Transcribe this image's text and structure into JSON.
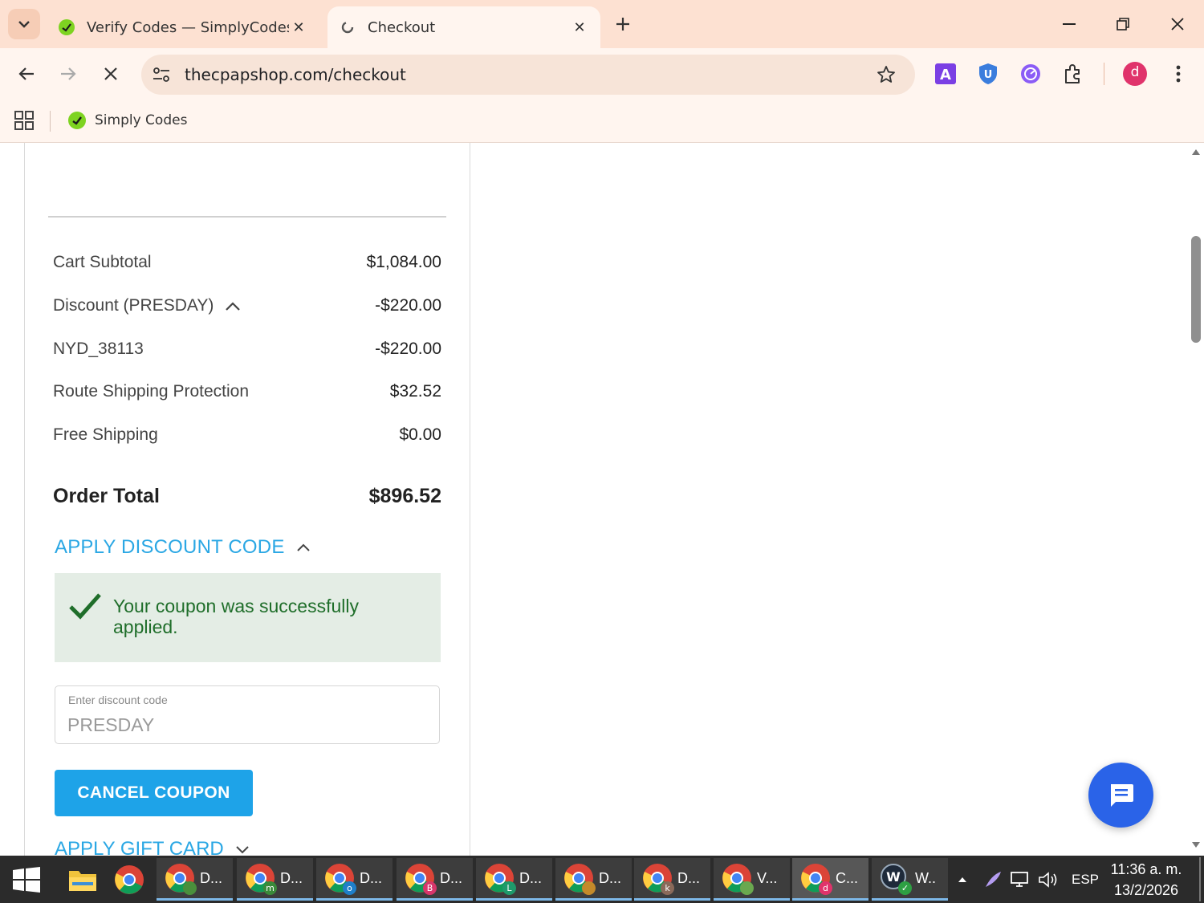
{
  "browser": {
    "tabs": [
      {
        "title": "Verify Codes — SimplyCodes",
        "active": false
      },
      {
        "title": "Checkout",
        "active": true
      }
    ],
    "url": "thecpapshop.com/checkout",
    "bookmarks": [
      {
        "label": "Simply Codes"
      }
    ],
    "profile_initial": "d",
    "extensions": [
      "a-extension-icon",
      "shield-extension-icon",
      "gauge-extension-icon",
      "puzzle-extensions-icon"
    ]
  },
  "summary": {
    "rows": [
      {
        "label": "Cart Subtotal",
        "amount": "$1,084.00"
      },
      {
        "label": "Discount (PRESDAY)",
        "amount": "-$220.00"
      },
      {
        "label": "NYD_38113",
        "amount": "-$220.00"
      },
      {
        "label": "Route Shipping Protection",
        "amount": "$32.52"
      },
      {
        "label": "Free Shipping",
        "amount": "$0.00"
      }
    ],
    "total_label": "Order Total",
    "total_amount": "$896.52"
  },
  "discount": {
    "heading": "APPLY DISCOUNT CODE",
    "success_message": "Your coupon was successfully applied.",
    "input_label": "Enter discount code",
    "input_value": "PRESDAY",
    "cancel_label": "CANCEL COUPON"
  },
  "gift_card": {
    "heading": "APPLY GIFT CARD"
  },
  "taskbar": {
    "apps": [
      {
        "label": "D...",
        "badge": "",
        "badge_color": "#4a8f3c"
      },
      {
        "label": "D...",
        "badge": "m",
        "badge_color": "#3a8a3a"
      },
      {
        "label": "D...",
        "badge": "o",
        "badge_color": "#1f7fc9"
      },
      {
        "label": "D...",
        "badge": "B",
        "badge_color": "#d8366b"
      },
      {
        "label": "D...",
        "badge": "L",
        "badge_color": "#1f9a6b"
      },
      {
        "label": "D...",
        "badge": "",
        "badge_color": "#c48a2a"
      },
      {
        "label": "D...",
        "badge": "k",
        "badge_color": "#8a6a5a"
      },
      {
        "label": "V...",
        "badge": "",
        "badge_color": "#6aa84f"
      },
      {
        "label": "C...",
        "badge": "d",
        "badge_color": "#e0336b"
      },
      {
        "label": "W..",
        "badge": "",
        "badge_color": "#2ea043"
      }
    ],
    "language": "ESP",
    "time": "11:36 a. m.",
    "date": "13/2/2026"
  },
  "colors": {
    "accent_blue": "#2aa7e4",
    "button_blue": "#1ea3e8",
    "success_bg": "#e4ede5",
    "success_text": "#1f6e2a",
    "chrome_bg": "#fde1d2",
    "chat_fab": "#2a63e8"
  }
}
